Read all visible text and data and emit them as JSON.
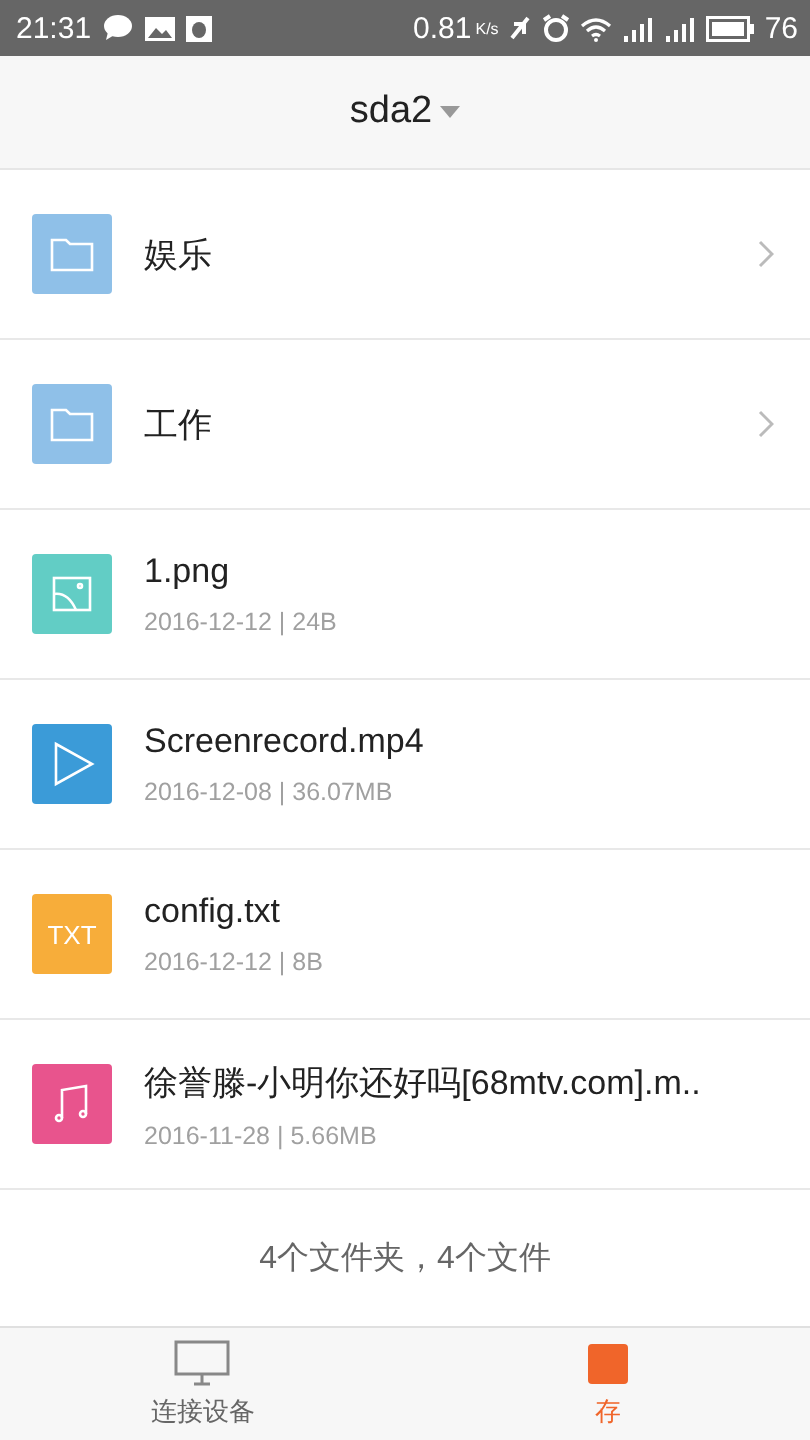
{
  "status_bar": {
    "time": "21:31",
    "speed": "0.81",
    "speed_unit": "K/s",
    "battery": "76"
  },
  "header": {
    "title": "sda2"
  },
  "items": [
    {
      "kind": "folder",
      "name": "娱乐"
    },
    {
      "kind": "folder",
      "name": "工作"
    },
    {
      "kind": "image",
      "name": "1.png",
      "meta": "2016-12-12 | 24B"
    },
    {
      "kind": "video",
      "name": "Screenrecord.mp4",
      "meta": "2016-12-08 | 36.07MB"
    },
    {
      "kind": "text",
      "name": "config.txt",
      "meta": "2016-12-12 | 8B",
      "badge": "TXT"
    },
    {
      "kind": "audio",
      "name": "徐誉滕-小明你还好吗[68mtv.com].m..",
      "meta": "2016-11-28 | 5.66MB"
    }
  ],
  "summary": "4个文件夹，4个文件",
  "tabs": [
    {
      "label": "连接设备",
      "kind": "monitor",
      "selected": false
    },
    {
      "label": "存",
      "kind": "storage",
      "selected": true
    }
  ]
}
